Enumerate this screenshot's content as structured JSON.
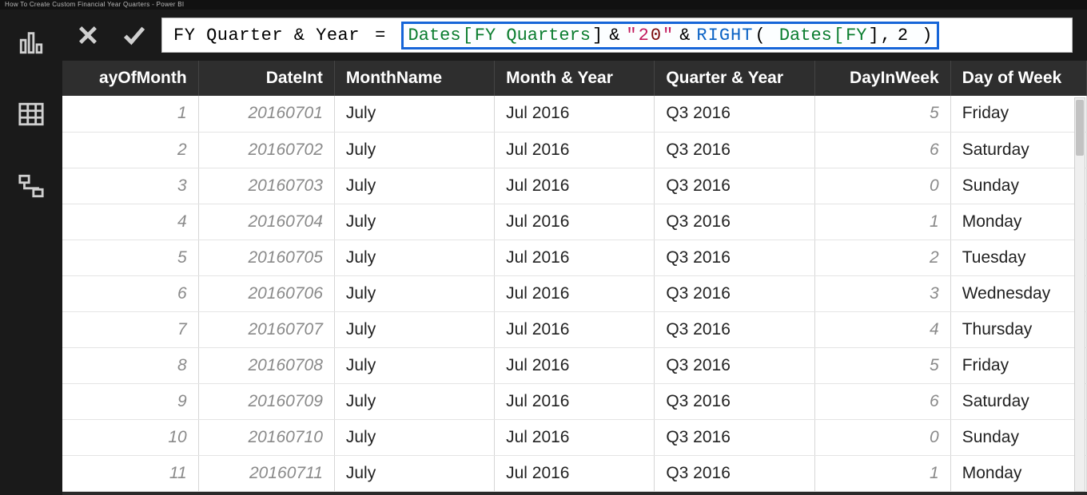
{
  "video_title": "How To Create Custom Financial Year Quarters - Power BI",
  "formula": {
    "measure_name": "FY Quarter & Year",
    "tokens": {
      "tbl1": "Dates",
      "col1_open": "[",
      "col1": "FY Quarters",
      "col1_close": "]",
      "amp": "&",
      "str_open": "\"",
      "str_body": " 2",
      "cursor_char": "0",
      "str_close": "\"",
      "func": "RIGHT",
      "paren_open": "(",
      "tbl2": "Dates",
      "col2_open": "[",
      "col2": "FY",
      "col2_close": "]",
      "comma": ",",
      "arg2": "2",
      "paren_close": ")"
    }
  },
  "columns": {
    "dayOfMonth": "ayOfMonth",
    "dateInt": "DateInt",
    "monthName": "MonthName",
    "monthYear": "Month & Year",
    "quarterYear": "Quarter & Year",
    "dayInWeek": "DayInWeek",
    "dayOfWeek": "Day of Week"
  },
  "rows": [
    {
      "dom": "1",
      "dint": "20160701",
      "mname": "July",
      "my": "Jul 2016",
      "qy": "Q3 2016",
      "diw": "5",
      "dow": "Friday"
    },
    {
      "dom": "2",
      "dint": "20160702",
      "mname": "July",
      "my": "Jul 2016",
      "qy": "Q3 2016",
      "diw": "6",
      "dow": "Saturday"
    },
    {
      "dom": "3",
      "dint": "20160703",
      "mname": "July",
      "my": "Jul 2016",
      "qy": "Q3 2016",
      "diw": "0",
      "dow": "Sunday"
    },
    {
      "dom": "4",
      "dint": "20160704",
      "mname": "July",
      "my": "Jul 2016",
      "qy": "Q3 2016",
      "diw": "1",
      "dow": "Monday"
    },
    {
      "dom": "5",
      "dint": "20160705",
      "mname": "July",
      "my": "Jul 2016",
      "qy": "Q3 2016",
      "diw": "2",
      "dow": "Tuesday"
    },
    {
      "dom": "6",
      "dint": "20160706",
      "mname": "July",
      "my": "Jul 2016",
      "qy": "Q3 2016",
      "diw": "3",
      "dow": "Wednesday"
    },
    {
      "dom": "7",
      "dint": "20160707",
      "mname": "July",
      "my": "Jul 2016",
      "qy": "Q3 2016",
      "diw": "4",
      "dow": "Thursday"
    },
    {
      "dom": "8",
      "dint": "20160708",
      "mname": "July",
      "my": "Jul 2016",
      "qy": "Q3 2016",
      "diw": "5",
      "dow": "Friday"
    },
    {
      "dom": "9",
      "dint": "20160709",
      "mname": "July",
      "my": "Jul 2016",
      "qy": "Q3 2016",
      "diw": "6",
      "dow": "Saturday"
    },
    {
      "dom": "10",
      "dint": "20160710",
      "mname": "July",
      "my": "Jul 2016",
      "qy": "Q3 2016",
      "diw": "0",
      "dow": "Sunday"
    },
    {
      "dom": "11",
      "dint": "20160711",
      "mname": "July",
      "my": "Jul 2016",
      "qy": "Q3 2016",
      "diw": "1",
      "dow": "Monday"
    }
  ],
  "icons": {
    "report": "report-view-icon",
    "data": "data-view-icon",
    "model": "model-view-icon",
    "cancel": "close-icon",
    "commit": "checkmark-icon"
  }
}
